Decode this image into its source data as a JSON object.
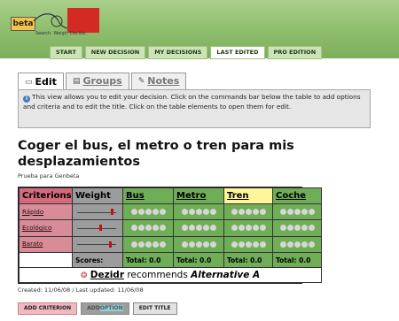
{
  "brand": {
    "logo_text": "beta",
    "tagline": "Search. Weigh. Decide."
  },
  "nav": {
    "items": [
      "START",
      "NEW DECISION",
      "MY DECISIONS",
      "LAST EDITED",
      "PRO EDITION"
    ],
    "active": "LAST EDITED"
  },
  "tabs": [
    {
      "label": "Edit",
      "icon": "note-icon"
    },
    {
      "label": "Groups",
      "icon": "folder-icon"
    },
    {
      "label": "Notes",
      "icon": "paperclip-icon"
    }
  ],
  "info": {
    "icon": "info-icon",
    "text": "This view allows you to edit your decision. Click on the commands bar below the table to add options and criteria and to edit the title. Click on the table elements to open them for edit."
  },
  "decision": {
    "title": "Coger el bus, el metro o tren para mis desplazamientos",
    "subtitle": "Prueba para Genbeta",
    "headers": {
      "criterions": "Criterions",
      "weight": "Weight"
    },
    "alternatives": [
      "Bus",
      "Metro",
      "Tren",
      "Coche"
    ],
    "selected_alternative": "Tren",
    "criteria": [
      {
        "name": "Rápido",
        "weight_fraction": 0.92
      },
      {
        "name": "Ecológico",
        "weight_fraction": 0.6
      },
      {
        "name": "Barato",
        "weight_fraction": 0.88
      }
    ],
    "dots_per_cell": 5,
    "scores_label": "Scores:",
    "totals": [
      "Total: 0.0",
      "Total: 0.0",
      "Total: 0.0",
      "Total: 0.0"
    ],
    "recommendation": {
      "icon": "dezidr-logo-icon",
      "name": "Dezidr",
      "text": "recommends",
      "alternative": "Alternative A"
    },
    "dates": "Created: 11/06/08 / Last updated: 11/06/08"
  },
  "actions": {
    "add_criterion": "ADD CRITERION",
    "add_option_prefix": "ADD",
    "add_option_highlight": "OPTION",
    "edit_title": "EDIT TITLE"
  },
  "colors": {
    "header_green": "#8dbd6c",
    "criterion_red": "#d46a7c",
    "alternative_green": "#6fad56",
    "weight_grey": "#9c9c9c",
    "selected_yellow": "#fff59a"
  }
}
